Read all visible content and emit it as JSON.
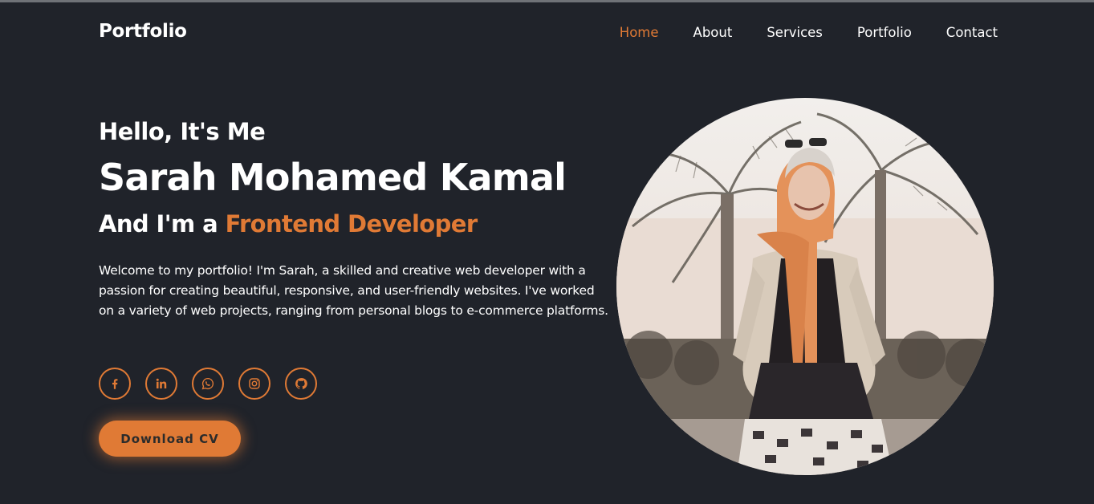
{
  "brand": {
    "logo_text": "Portfolio"
  },
  "nav": {
    "items": [
      {
        "label": "Home",
        "active": true
      },
      {
        "label": "About",
        "active": false
      },
      {
        "label": "Services",
        "active": false
      },
      {
        "label": "Portfolio",
        "active": false
      },
      {
        "label": "Contact",
        "active": false
      }
    ]
  },
  "hero": {
    "greeting": "Hello, It's Me",
    "name": "Sarah Mohamed Kamal",
    "role_prefix": "And I'm a ",
    "role_highlight": "Frontend Developer",
    "intro": "Welcome to my portfolio! I'm Sarah, a skilled and creative web developer with a passion for creating beautiful, responsive, and user-friendly websites. I've worked on a variety of web projects, ranging from personal blogs to e-commerce platforms.",
    "download_label": "Download CV"
  },
  "socials": [
    {
      "icon": "facebook-icon"
    },
    {
      "icon": "linkedin-icon"
    },
    {
      "icon": "whatsapp-icon"
    },
    {
      "icon": "instagram-icon"
    },
    {
      "icon": "github-icon"
    }
  ],
  "colors": {
    "background": "#20232a",
    "accent": "#e07a35",
    "text": "#ffffff"
  }
}
